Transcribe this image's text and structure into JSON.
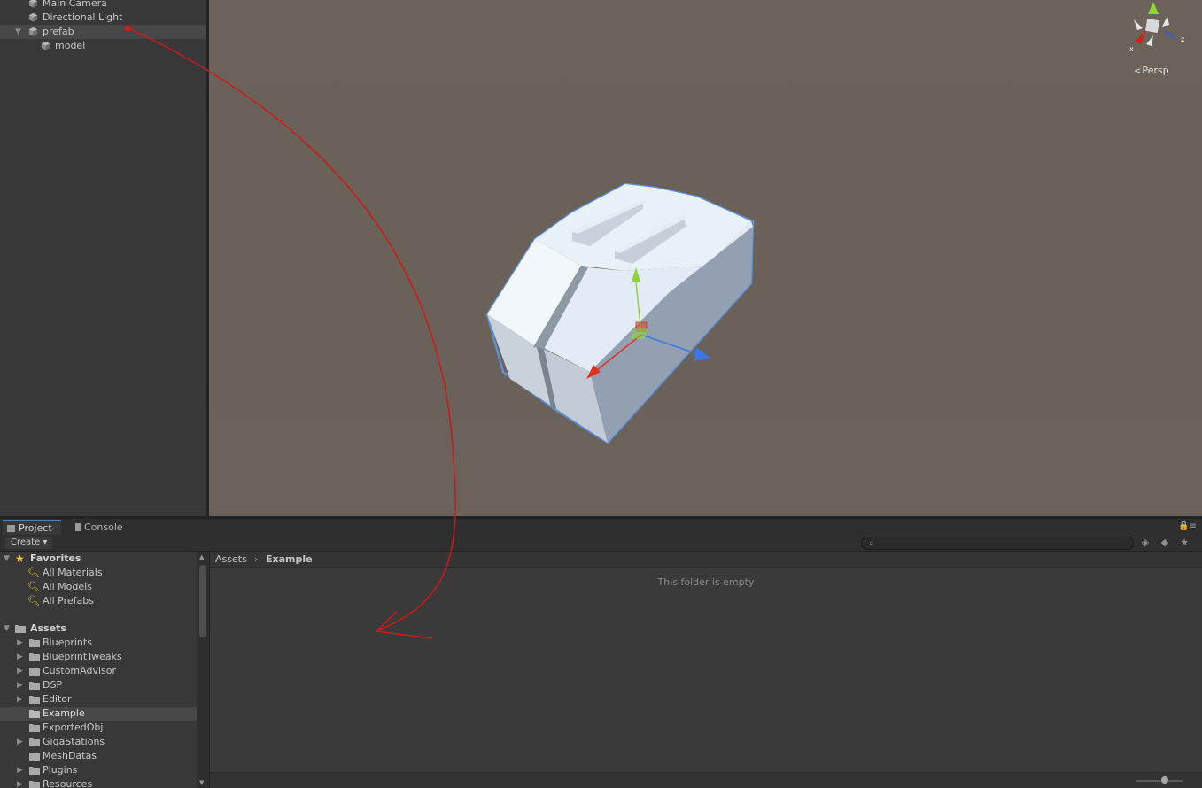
{
  "hierarchy": {
    "items": [
      {
        "label": "Main Camera",
        "expandable": false,
        "selected": false
      },
      {
        "label": "Directional Light",
        "expandable": false,
        "selected": false
      },
      {
        "label": "prefab",
        "expandable": true,
        "expanded": true,
        "selected": true
      },
      {
        "label": "model",
        "expandable": false,
        "selected": false
      }
    ]
  },
  "scene": {
    "view_mode": "Persp",
    "gizmo_axes": [
      "x",
      "z"
    ]
  },
  "project": {
    "tabs": [
      {
        "label": "Project",
        "active": true
      },
      {
        "label": "Console",
        "active": false
      }
    ],
    "create_label": "Create",
    "search_value": "",
    "favorites": {
      "label": "Favorites",
      "items": [
        "All Materials",
        "All Models",
        "All Prefabs"
      ]
    },
    "assets": {
      "label": "Assets",
      "items": [
        {
          "label": "Blueprints",
          "expandable": true
        },
        {
          "label": "BlueprintTweaks",
          "expandable": true
        },
        {
          "label": "CustomAdvisor",
          "expandable": true
        },
        {
          "label": "DSP",
          "expandable": true
        },
        {
          "label": "Editor",
          "expandable": true
        },
        {
          "label": "Example",
          "expandable": false,
          "selected": true
        },
        {
          "label": "ExportedObj",
          "expandable": false
        },
        {
          "label": "GigaStations",
          "expandable": true
        },
        {
          "label": "MeshDatas",
          "expandable": false
        },
        {
          "label": "Plugins",
          "expandable": true
        },
        {
          "label": "Resources",
          "expandable": true
        }
      ]
    },
    "breadcrumb": [
      "Assets",
      "Example"
    ],
    "empty_message": "This folder is empty"
  },
  "colors": {
    "selection_outline": "#5b8fd6",
    "annotation_arrow": "#d01818",
    "axis_x": "#e0301e",
    "axis_y": "#8cd63a",
    "axis_z": "#3a78e8"
  }
}
